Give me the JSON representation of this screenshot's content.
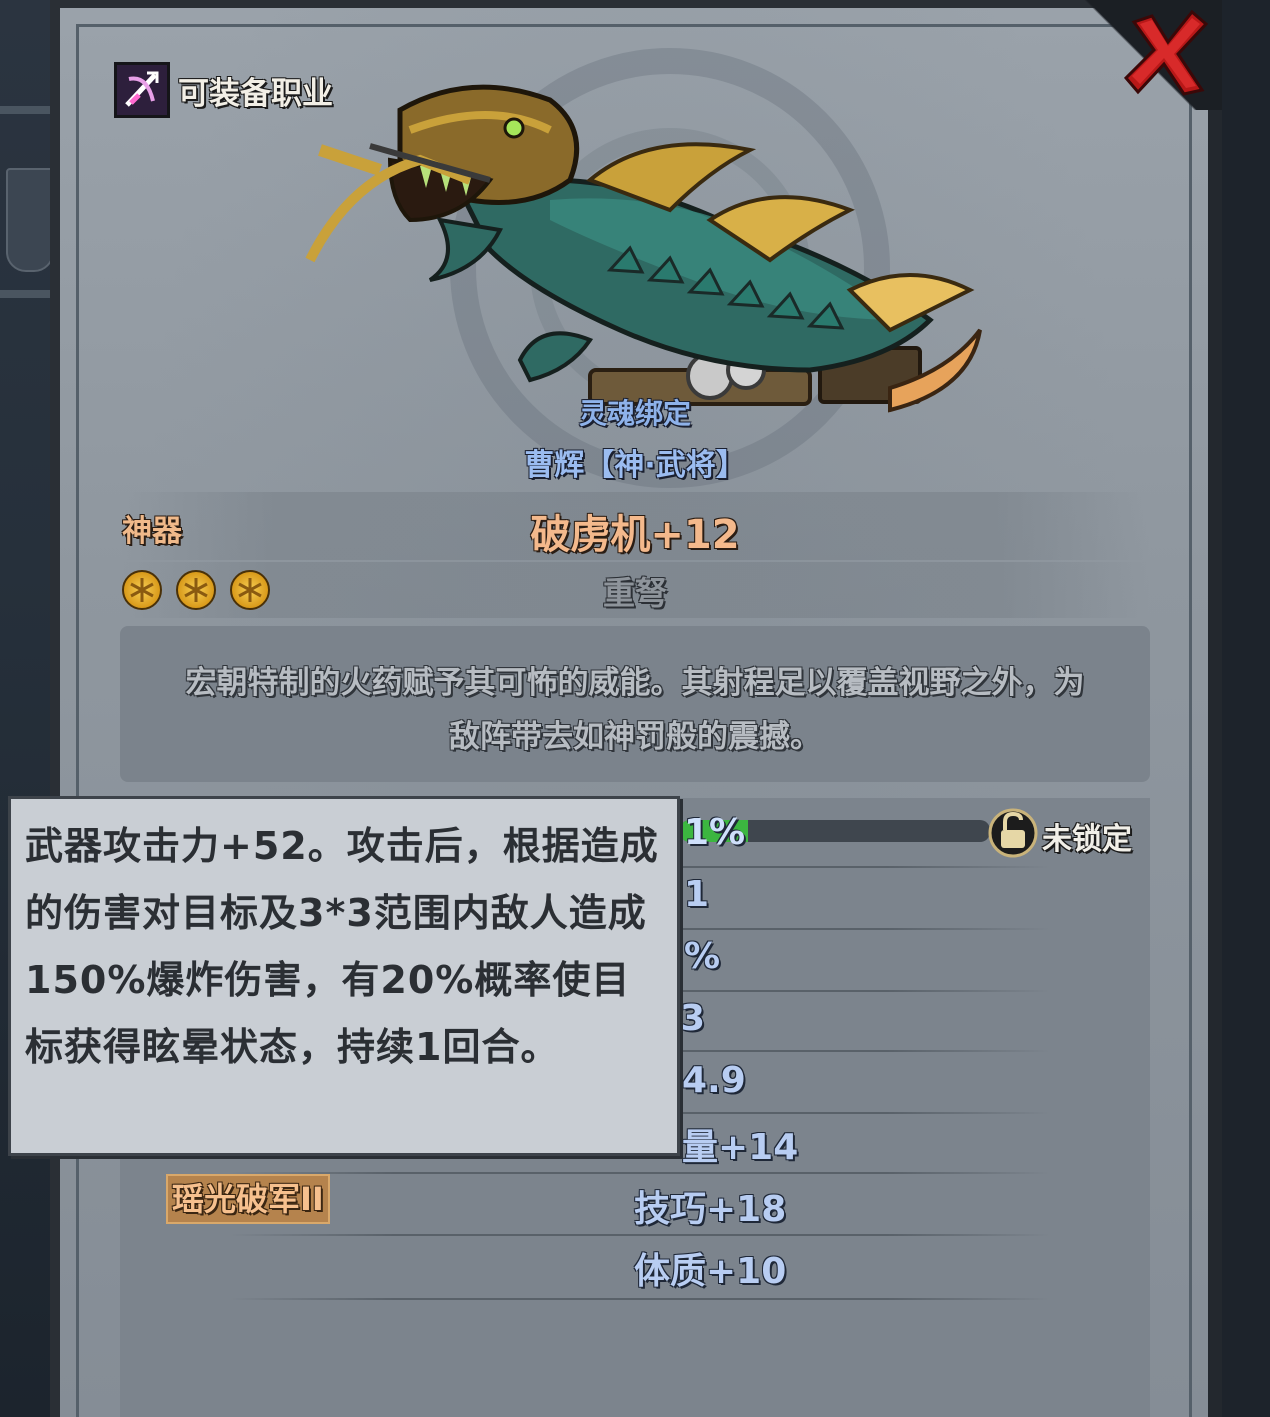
{
  "header": {
    "class_label": "可装备职业",
    "soulbound": "灵魂绑定",
    "owner": "曹辉【神·武将】"
  },
  "item": {
    "rarity": "神器",
    "name": "破虏机+12",
    "type": "重弩",
    "stars": 3,
    "description": "宏朝特制的火药赋予其可怖的威能。其射程足以覆盖视野之外，为敌阵带去如神罚般的震撼。"
  },
  "progress": {
    "text": "1%",
    "value_percent": 1
  },
  "lock": {
    "label": "未锁定"
  },
  "stats": {
    "partial": [
      "1",
      "%",
      "3",
      "4.9",
      "量+14"
    ],
    "full": [
      "技巧+18",
      "体质+10"
    ]
  },
  "skill": {
    "label": "瑶光破军II"
  },
  "tooltip": {
    "text": "武器攻击力+52。攻击后，根据造成的伤害对目标及3*3范围内敌人造成150%爆炸伤害，有20%概率使目标获得眩晕状态，持续1回合。"
  },
  "colors": {
    "rarity": "#f0b98a",
    "stat": "#b8cdf2",
    "progress": "#3cb640",
    "close": "#c41c1c"
  }
}
